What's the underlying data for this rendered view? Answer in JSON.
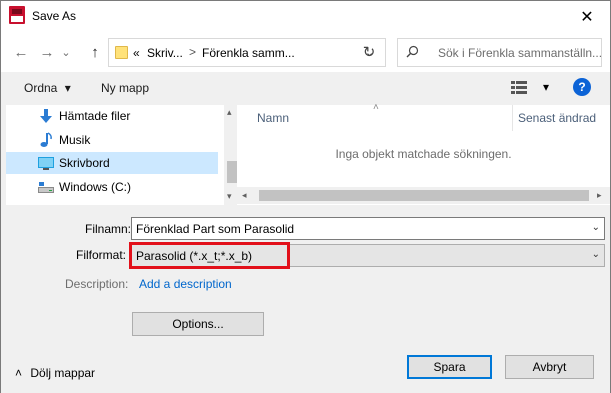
{
  "window": {
    "title": "Save As",
    "close_symbol": "✕"
  },
  "navigation": {
    "back_symbol": "←",
    "forward_symbol": "→",
    "recent_symbol": "⌄",
    "up_symbol": "↑",
    "address": {
      "overflow": "«",
      "segments": [
        "Skriv...",
        "Förenkla samm..."
      ],
      "separator": ">"
    },
    "refresh_symbol": "↻",
    "search_placeholder": "Sök i Förenkla sammanställn..."
  },
  "toolbar": {
    "organize_label": "Ordna",
    "organize_arrow": "▾",
    "new_folder_label": "Ny mapp",
    "view_arrow": "▾",
    "help_label": "?"
  },
  "sidebar": {
    "items": [
      {
        "label": "Hämtade filer",
        "icon": "download-icon",
        "selected": false
      },
      {
        "label": "Musik",
        "icon": "music-icon",
        "selected": false
      },
      {
        "label": "Skrivbord",
        "icon": "desktop-icon",
        "selected": true
      },
      {
        "label": "Windows  (C:)",
        "icon": "drive-icon",
        "selected": false
      }
    ],
    "scroll_up": "▴",
    "scroll_down": "▾"
  },
  "file_list": {
    "sort_indicator": "˄",
    "columns": [
      "Namn",
      "Senast ändrad"
    ],
    "empty_message": "Inga objekt matchade sökningen.",
    "scroll_left": "◂",
    "scroll_right": "▸"
  },
  "form": {
    "filename_label": "Filnamn:",
    "filename_value": "Förenklad Part som Parasolid",
    "format_label": "Filformat:",
    "format_value": "Parasolid (*.x_t;*.x_b)",
    "dropdown_arrow": "⌄",
    "description_label": "Description:",
    "description_link": "Add a description",
    "options_button": "Options...",
    "hide_folders": "Dölj mappar",
    "hide_folders_arrow": "˄",
    "save_button": "Spara",
    "cancel_button": "Avbryt"
  },
  "colors": {
    "accent": "#0078d7",
    "highlight_box": "#e2101a",
    "selection": "#cce8ff",
    "link": "#0066cc"
  }
}
